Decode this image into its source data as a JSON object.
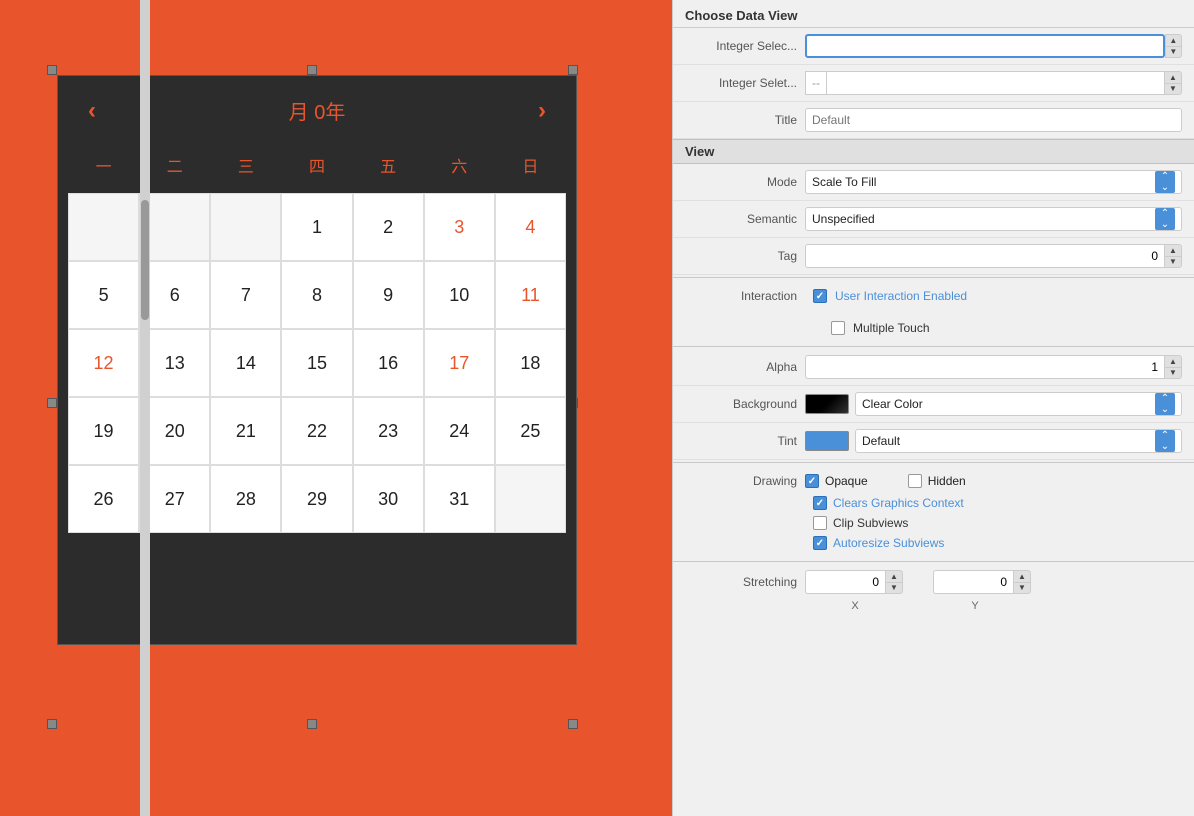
{
  "canvas": {
    "calendar": {
      "title": "月 0年",
      "nav_left": "‹",
      "nav_right": "›",
      "weekdays": [
        "一",
        "二",
        "三",
        "四",
        "五",
        "六",
        "日"
      ],
      "rows": [
        [
          "",
          "",
          "",
          "1",
          "2",
          "3",
          "4"
        ],
        [
          "5",
          "6",
          "7",
          "8",
          "9",
          "10",
          "11"
        ],
        [
          "12",
          "13",
          "14",
          "15",
          "16",
          "17",
          "18"
        ],
        [
          "19",
          "20",
          "21",
          "22",
          "23",
          "24",
          "25"
        ],
        [
          "26",
          "27",
          "28",
          "29",
          "30",
          "31",
          ""
        ]
      ],
      "weekend_cols": [
        5,
        6
      ],
      "sunday_col": 6
    }
  },
  "panel": {
    "choose_data_header": "Choose Data View",
    "fields": {
      "integer_select1_label": "Integer Selec...",
      "integer_select1_placeholder": "--",
      "integer_select2_label": "Integer Selet...",
      "integer_select2_placeholder": "--",
      "title_label": "Title",
      "title_placeholder": "Default"
    },
    "view_section": "View",
    "mode_label": "Mode",
    "mode_value": "Scale To Fill",
    "semantic_label": "Semantic",
    "semantic_value": "Unspecified",
    "tag_label": "Tag",
    "tag_value": "0",
    "interaction_label": "Interaction",
    "user_interaction": "User Interaction Enabled",
    "multiple_touch": "Multiple Touch",
    "alpha_label": "Alpha",
    "alpha_value": "1",
    "background_label": "Background",
    "background_value": "Clear Color",
    "tint_label": "Tint",
    "tint_value": "Default",
    "drawing_label": "Drawing",
    "opaque_label": "Opaque",
    "hidden_label": "Hidden",
    "clears_graphics_label": "Clears Graphics Context",
    "clip_subviews_label": "Clip Subviews",
    "autoresize_label": "Autoresize Subviews",
    "stretching_label": "Stretching",
    "stretching_x_label": "X",
    "stretching_x_value": "0",
    "stretching_y_label": "Y",
    "stretching_y_value": "0"
  }
}
